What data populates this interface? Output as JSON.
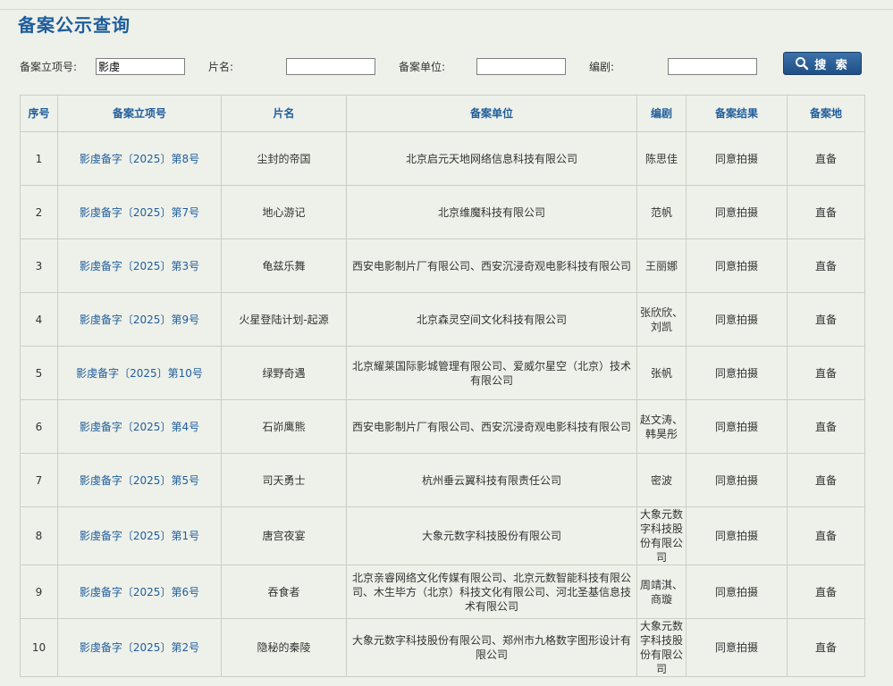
{
  "page": {
    "title": "备案公示查询"
  },
  "search": {
    "record_no_label": "备案立项号:",
    "record_no_value": "影虔",
    "title_label": "片名:",
    "title_value": "",
    "unit_label": "备案单位:",
    "unit_value": "",
    "writer_label": "编剧:",
    "writer_value": "",
    "button_label": "搜 索"
  },
  "table": {
    "headers": [
      "序号",
      "备案立项号",
      "片名",
      "备案单位",
      "编剧",
      "备案结果",
      "备案地"
    ],
    "rows": [
      {
        "index": "1",
        "record_no": "影虔备字〔2025〕第8号",
        "title": "尘封的帝国",
        "unit": "北京启元天地网络信息科技有限公司",
        "writer": "陈思佳",
        "result": "同意拍摄",
        "place": "直备"
      },
      {
        "index": "2",
        "record_no": "影虔备字〔2025〕第7号",
        "title": "地心游记",
        "unit": "北京维魔科技有限公司",
        "writer": "范帆",
        "result": "同意拍摄",
        "place": "直备"
      },
      {
        "index": "3",
        "record_no": "影虔备字〔2025〕第3号",
        "title": "龟兹乐舞",
        "unit": "西安电影制片厂有限公司、西安沉浸奇观电影科技有限公司",
        "writer": "王丽娜",
        "result": "同意拍摄",
        "place": "直备"
      },
      {
        "index": "4",
        "record_no": "影虔备字〔2025〕第9号",
        "title": "火星登陆计划-起源",
        "unit": "北京森灵空间文化科技有限公司",
        "writer": "张欣欣、刘凯",
        "result": "同意拍摄",
        "place": "直备"
      },
      {
        "index": "5",
        "record_no": "影虔备字〔2025〕第10号",
        "title": "绿野奇遇",
        "unit": "北京耀莱国际影城管理有限公司、爱威尔星空（北京）技术有限公司",
        "writer": "张帆",
        "result": "同意拍摄",
        "place": "直备"
      },
      {
        "index": "6",
        "record_no": "影虔备字〔2025〕第4号",
        "title": "石峁鹰熊",
        "unit": "西安电影制片厂有限公司、西安沉浸奇观电影科技有限公司",
        "writer": "赵文涛、韩昊彤",
        "result": "同意拍摄",
        "place": "直备"
      },
      {
        "index": "7",
        "record_no": "影虔备字〔2025〕第5号",
        "title": "司天勇士",
        "unit": "杭州垂云翼科技有限责任公司",
        "writer": "密波",
        "result": "同意拍摄",
        "place": "直备"
      },
      {
        "index": "8",
        "record_no": "影虔备字〔2025〕第1号",
        "title": "唐宫夜宴",
        "unit": "大象元数字科技股份有限公司",
        "writer": "大象元数字科技股份有限公司",
        "result": "同意拍摄",
        "place": "直备"
      },
      {
        "index": "9",
        "record_no": "影虔备字〔2025〕第6号",
        "title": "吞食者",
        "unit": "北京亲睿网络文化传媒有限公司、北京元数智能科技有限公司、木生毕方（北京）科技文化有限公司、河北圣基信息技术有限公司",
        "writer": "周靖淇、商璇",
        "result": "同意拍摄",
        "place": "直备"
      },
      {
        "index": "10",
        "record_no": "影虔备字〔2025〕第2号",
        "title": "隐秘的秦陵",
        "unit": "大象元数字科技股份有限公司、郑州市九格数字图形设计有限公司",
        "writer": "大象元数字科技股份有限公司",
        "result": "同意拍摄",
        "place": "直备"
      }
    ]
  },
  "colors": {
    "background": "#eef1ea",
    "accent": "#1f5d9c",
    "border": "#c9cec4"
  }
}
